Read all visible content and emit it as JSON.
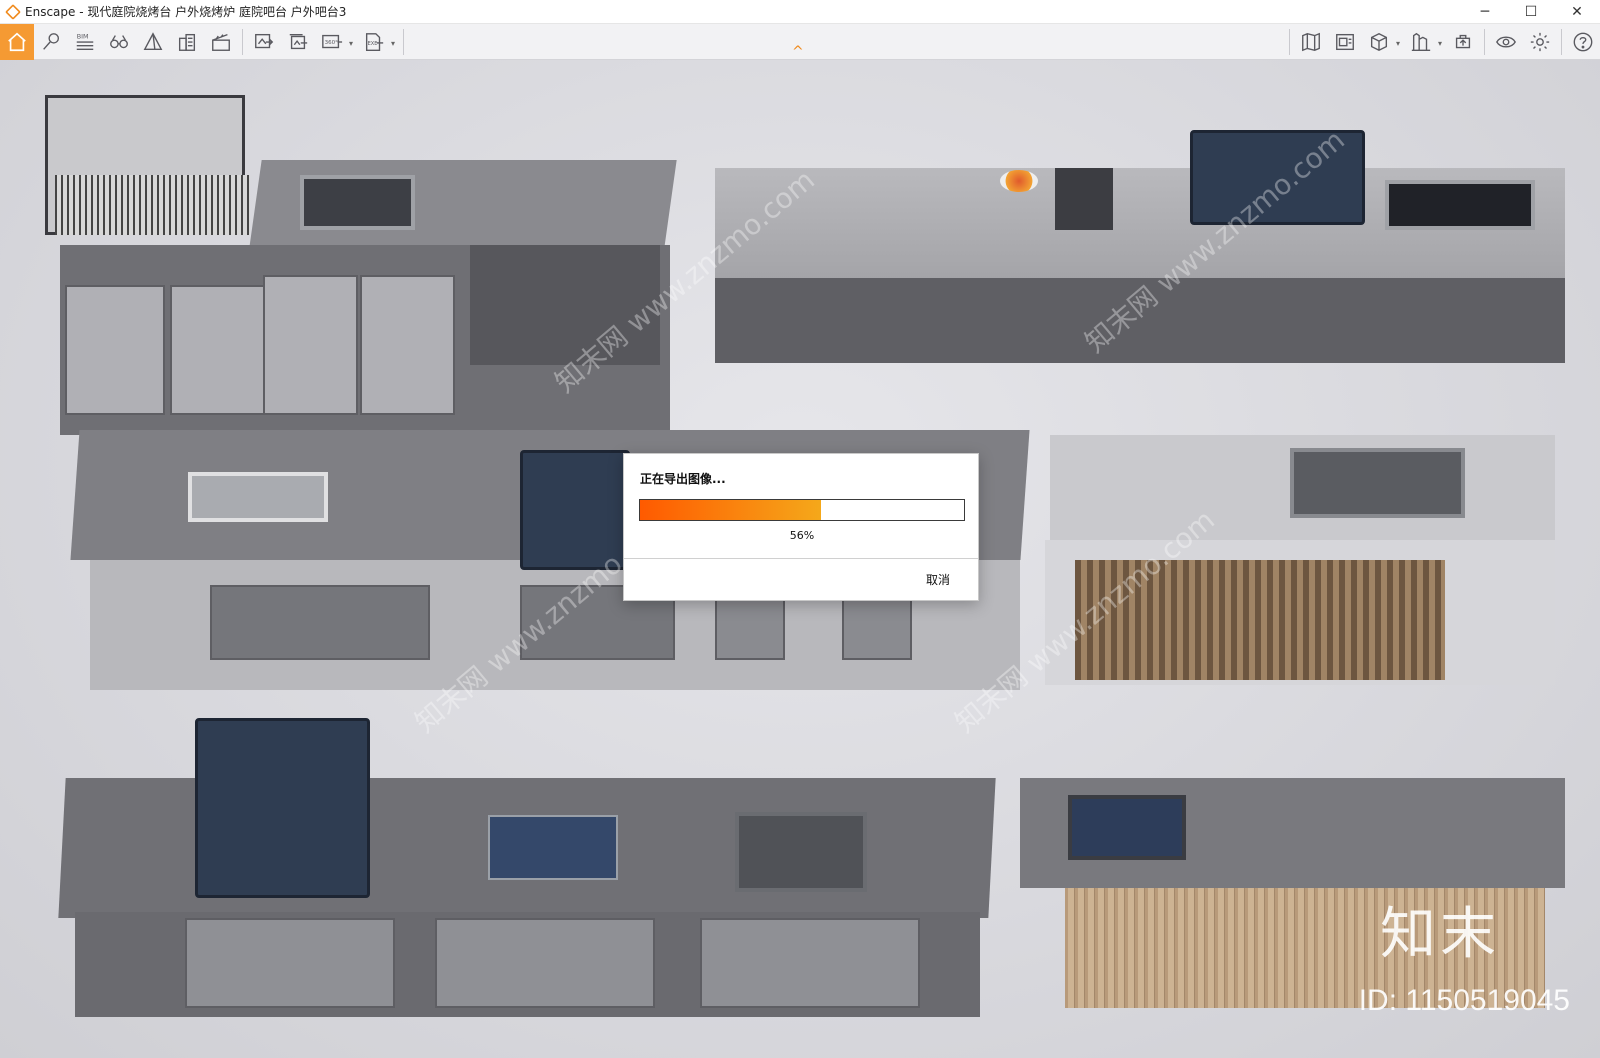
{
  "window": {
    "app_name": "Enscape",
    "separator": " - ",
    "document_title": "现代庭院烧烤台 户外烧烤炉 庭院吧台 户外吧台3",
    "controls": {
      "minimize": "─",
      "maximize": "☐",
      "close": "✕"
    }
  },
  "toolbar": {
    "left_tools": [
      {
        "icon": "home-icon"
      },
      {
        "icon": "pin-icon"
      },
      {
        "icon": "bim-icon",
        "label": "BIM"
      },
      {
        "icon": "binoculars-icon"
      },
      {
        "icon": "pyramid-icon"
      },
      {
        "icon": "buildings-icon"
      },
      {
        "icon": "clapper-icon"
      },
      {
        "icon": "export-image-icon"
      },
      {
        "icon": "batch-export-icon"
      },
      {
        "icon": "panorama-icon",
        "label": "360°"
      },
      {
        "icon": "exe-export-icon",
        "label": "EXE"
      }
    ],
    "right_tools": [
      {
        "icon": "map-icon"
      },
      {
        "icon": "material-editor-icon"
      },
      {
        "icon": "cube-icon"
      },
      {
        "icon": "asset-library-icon"
      },
      {
        "icon": "upload-icon"
      },
      {
        "icon": "eye-icon"
      },
      {
        "icon": "settings-gear-icon"
      },
      {
        "icon": "help-icon"
      }
    ],
    "collapse_symbol": "^"
  },
  "colors": {
    "accent": "#f59a33",
    "progress_start": "#ff5a00",
    "progress_end": "#f5a81a"
  },
  "export_dialog": {
    "title": "正在导出图像...",
    "progress": 0.56,
    "progress_label": "56%",
    "cancel_label": "取消"
  },
  "watermark": {
    "text": "知末网 www.znzmo.com",
    "brand": "知末",
    "id_text": "ID: 1150519045"
  }
}
